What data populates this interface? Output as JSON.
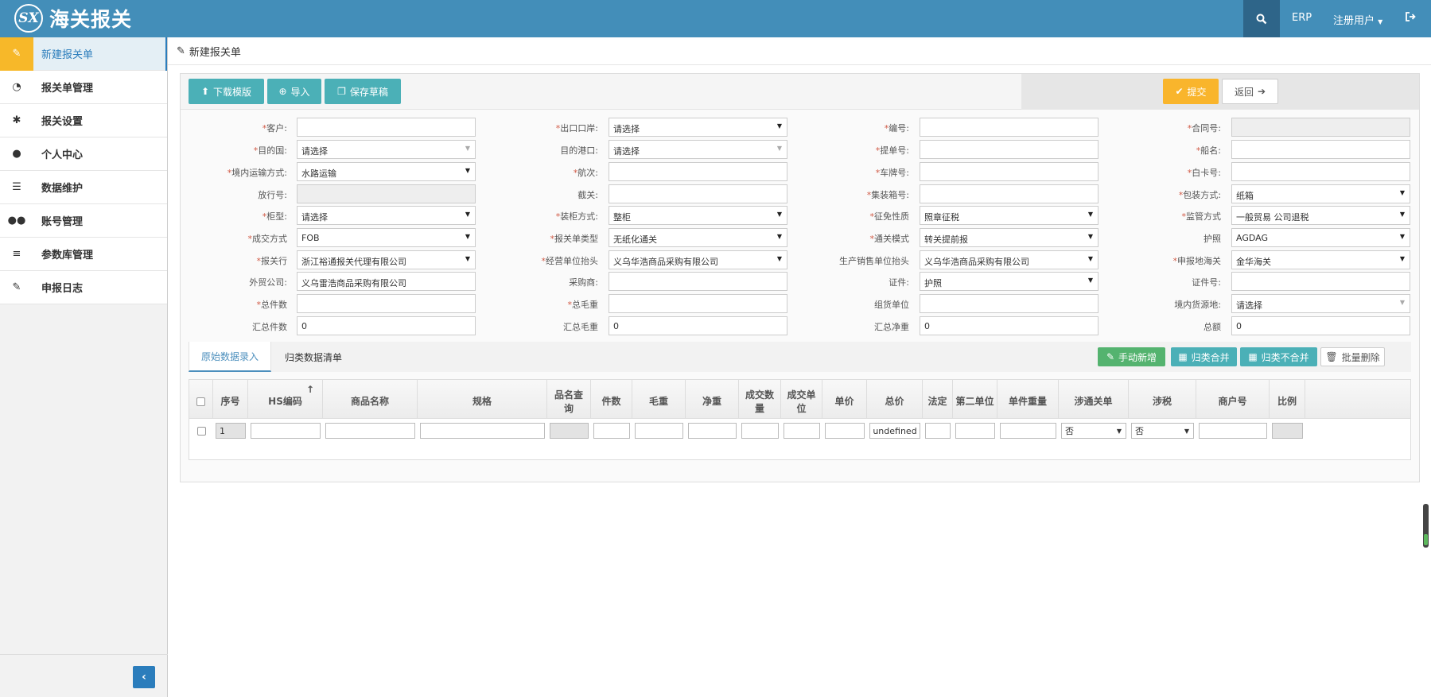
{
  "navbar": {
    "logo_text": "SX",
    "title": "海关报关",
    "erp_label": "ERP",
    "user_label": "注册用户",
    "search_icon": "search-icon",
    "logout_icon": "sign-out-icon"
  },
  "sidebar": {
    "items": [
      {
        "label": "新建报关单",
        "icon": "edit-icon"
      },
      {
        "label": "报关单管理",
        "icon": "dashboard-icon"
      },
      {
        "label": "报关设置",
        "icon": "cog-icon"
      },
      {
        "label": "个人中心",
        "icon": "user-icon"
      },
      {
        "label": "数据维护",
        "icon": "list-alt-icon"
      },
      {
        "label": "账号管理",
        "icon": "users-icon"
      },
      {
        "label": "参数库管理",
        "icon": "list-icon"
      },
      {
        "label": "申报日志",
        "icon": "edit-icon"
      }
    ],
    "collapse_icon": "angle-left-icon"
  },
  "breadcrumb": {
    "title": "新建报关单"
  },
  "toolbar": {
    "download_label": "下载模版",
    "import_label": "导入",
    "save_draft_label": "保存草稿",
    "submit_label": "提交",
    "back_label": "返回"
  },
  "form": {
    "r1": {
      "c1_label": "客户:",
      "c1_value": "",
      "c2_label": "出口口岸:",
      "c2_value": "请选择",
      "c3_label": "编号:",
      "c3_value": "",
      "c4_label": "合同号:",
      "c4_value": ""
    },
    "r2": {
      "c1_label": "目的国:",
      "c1_value": "请选择",
      "c2_label": "目的港口:",
      "c2_value": "请选择",
      "c3_label": "提单号:",
      "c3_value": "",
      "c4_label": "船名:",
      "c4_value": ""
    },
    "r3": {
      "c1_label": "境内运输方式:",
      "c1_value": "水路运输",
      "c2_label": "航次:",
      "c2_value": "",
      "c3_label": "车牌号:",
      "c3_value": "",
      "c4_label": "白卡号:",
      "c4_value": ""
    },
    "r4": {
      "c1_label": "放行号:",
      "c1_value": "",
      "c2_label": "截关:",
      "c2_value": "",
      "c3_label": "集装箱号:",
      "c3_value": "",
      "c4_label": "包装方式:",
      "c4_value": "纸箱"
    },
    "r5": {
      "c1_label": "柜型:",
      "c1_value": "请选择",
      "c2_label": "装柜方式:",
      "c2_value": "整柜",
      "c3_label": "征免性质",
      "c3_value": "照章征税",
      "c4_label": "监管方式",
      "c4_value": "一般贸易 公司退税"
    },
    "r6": {
      "c1_label": "成交方式",
      "c1_value": "FOB",
      "c2_label": "报关单类型",
      "c2_value": "无纸化通关",
      "c3_label": "通关模式",
      "c3_value": "转关提前报",
      "c4_label": "护照",
      "c4_value": "AGDAG"
    },
    "r7": {
      "c1_label": "报关行",
      "c1_value": "浙江裕通报关代理有限公司",
      "c2_label": "经营单位抬头",
      "c2_value": "义乌华浩商品采购有限公司",
      "c3_label": "生产销售单位抬头",
      "c3_value": "义乌华浩商品采购有限公司",
      "c4_label": "申报地海关",
      "c4_value": "金华海关"
    },
    "r8": {
      "c1_label": "外贸公司:",
      "c1_value": "义乌雷浩商品采购有限公司",
      "c2_label": "采购商:",
      "c2_value": "",
      "c3_label": "证件:",
      "c3_value": "护照",
      "c4_label": "证件号:",
      "c4_value": ""
    },
    "r9": {
      "c1_label": "总件数",
      "c1_value": "",
      "c2_label": "总毛重",
      "c2_value": "",
      "c3_label": "组货单位",
      "c3_value": "",
      "c4_label": "境内货源地:",
      "c4_value": "请选择"
    },
    "r10": {
      "c1_label": "汇总件数",
      "c1_value": "0",
      "c2_label": "汇总毛重",
      "c2_value": "0",
      "c3_label": "汇总净重",
      "c3_value": "0",
      "c4_label": "总额",
      "c4_value": "0"
    }
  },
  "tabs": {
    "raw_label": "原始数据录入",
    "classified_label": "归类数据清单",
    "manual_add_label": "手动新增",
    "merge_label": "归类合并",
    "no_merge_label": "归类不合并",
    "batch_delete_label": "批量删除"
  },
  "table": {
    "headers": {
      "seq": "序号",
      "hs": "HS编码",
      "name": "商品名称",
      "spec": "规格",
      "lookup": "品名查询",
      "pieces": "件数",
      "gross": "毛重",
      "net": "净重",
      "qty": "成交数量",
      "unit": "成交单位",
      "price": "单价",
      "total": "总价",
      "legal": "法定",
      "second_unit": "第二单位",
      "unit_weight": "单件重量",
      "customs_doc": "涉通关单",
      "tax": "涉税",
      "account": "商户号",
      "ratio": "比例"
    },
    "row": {
      "seq": "1",
      "total": "undefined",
      "customs_doc": "否",
      "tax": "否"
    }
  }
}
